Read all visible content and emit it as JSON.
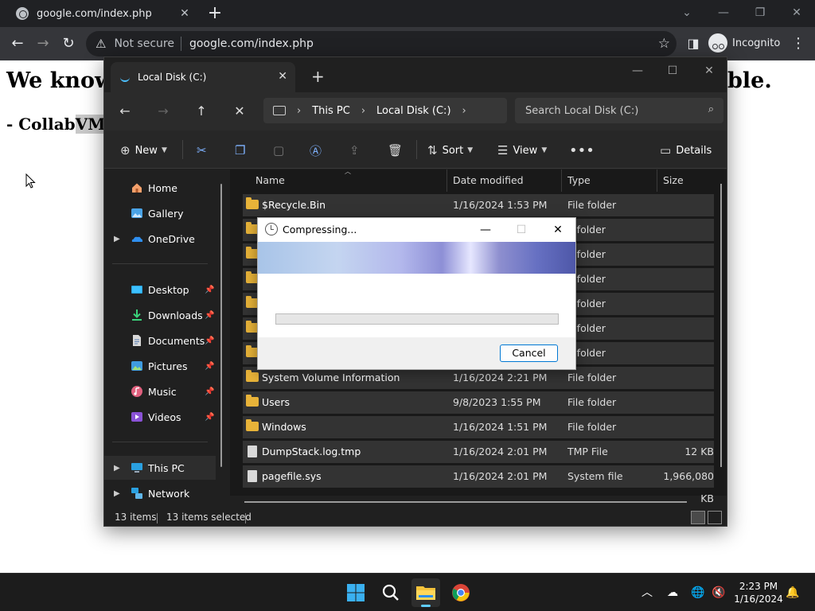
{
  "browser": {
    "tab_title": "google.com/index.php",
    "not_secure_label": "Not secure",
    "url": "google.com/index.php",
    "incognito_label": "Incognito",
    "new_tab_symbol": "+"
  },
  "webpage": {
    "heading_start": "We know",
    "heading_end": "ble.",
    "sub_start": "- Collab",
    "sub_highlight": "VM"
  },
  "explorer": {
    "tab_title": "Local Disk (C:)",
    "breadcrumb": [
      "This PC",
      "Local Disk (C:)"
    ],
    "search_placeholder": "Search Local Disk (C:)",
    "commands": {
      "new": "New",
      "sort": "Sort",
      "view": "View",
      "details": "Details"
    },
    "sidebar": {
      "top": [
        {
          "label": "Home",
          "icon": "home-icon"
        },
        {
          "label": "Gallery",
          "icon": "gallery-icon"
        },
        {
          "label": "OneDrive",
          "icon": "onedrive-icon"
        }
      ],
      "pinned": [
        {
          "label": "Desktop",
          "icon": "desktop-icon"
        },
        {
          "label": "Downloads",
          "icon": "downloads-icon"
        },
        {
          "label": "Documents",
          "icon": "documents-icon"
        },
        {
          "label": "Pictures",
          "icon": "pictures-icon"
        },
        {
          "label": "Music",
          "icon": "music-icon"
        },
        {
          "label": "Videos",
          "icon": "videos-icon"
        }
      ],
      "bottom": [
        {
          "label": "This PC",
          "icon": "this-pc-icon"
        },
        {
          "label": "Network",
          "icon": "network-icon"
        }
      ]
    },
    "columns": [
      "Name",
      "Date modified",
      "Type",
      "Size"
    ],
    "rows": [
      {
        "name": "$Recycle.Bin",
        "date": "1/16/2024 1:53 PM",
        "type": "File folder",
        "size": "",
        "icon": "folder-icon"
      },
      {
        "name": "",
        "date": "",
        "type": "e folder",
        "size": "",
        "icon": "shortcut-folder-icon"
      },
      {
        "name": "",
        "date": "",
        "type": "e folder",
        "size": "",
        "icon": "folder-icon"
      },
      {
        "name": "",
        "date": "",
        "type": "e folder",
        "size": "",
        "icon": "folder-icon"
      },
      {
        "name": "",
        "date": "",
        "type": "e folder",
        "size": "",
        "icon": "folder-icon"
      },
      {
        "name": "",
        "date": "",
        "type": "e folder",
        "size": "",
        "icon": "folder-icon"
      },
      {
        "name": "",
        "date": "",
        "type": "e folder",
        "size": "",
        "icon": "folder-icon"
      },
      {
        "name": "System Volume Information",
        "date": "1/16/2024 2:21 PM",
        "type": "File folder",
        "size": "",
        "icon": "folder-icon"
      },
      {
        "name": "Users",
        "date": "9/8/2023 1:55 PM",
        "type": "File folder",
        "size": "",
        "icon": "folder-icon"
      },
      {
        "name": "Windows",
        "date": "1/16/2024 1:51 PM",
        "type": "File folder",
        "size": "",
        "icon": "folder-icon"
      },
      {
        "name": "DumpStack.log.tmp",
        "date": "1/16/2024 2:01 PM",
        "type": "TMP File",
        "size": "12 KB",
        "icon": "file-icon"
      },
      {
        "name": "pagefile.sys",
        "date": "1/16/2024 2:01 PM",
        "type": "System file",
        "size": "1,966,080 KB",
        "icon": "file-icon"
      }
    ],
    "status": {
      "items": "13 items",
      "selected": "13 items selected"
    }
  },
  "dialog": {
    "title": "Compressing...",
    "cancel_label": "Cancel",
    "progress": 0
  },
  "taskbar": {
    "time": "2:23 PM",
    "date": "1/16/2024"
  },
  "colors": {
    "accent": "#0078d4",
    "folder": "#e8b339",
    "taskbar_indicator": "#60cdff"
  }
}
